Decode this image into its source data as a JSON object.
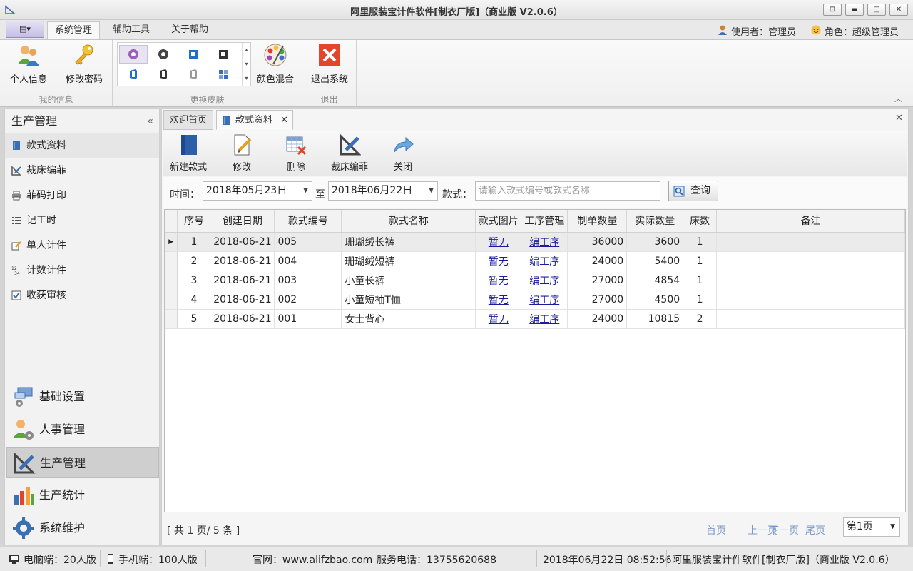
{
  "window": {
    "title": "阿里服装宝计件软件[制衣厂版]（商业版 V2.0.6）"
  },
  "menu": {
    "tabs": [
      {
        "label": "系统管理"
      },
      {
        "label": "辅助工具"
      },
      {
        "label": "关于帮助"
      }
    ],
    "user_label": "使用者：管理员",
    "role_label": "角色：超级管理员"
  },
  "ribbon": {
    "groups": {
      "my_info": "我的信息",
      "skins": "更换皮肤",
      "exit": "退出"
    },
    "buttons": {
      "profile": "个人信息",
      "change_password": "修改密码",
      "color_blend": "颜色混合",
      "exit_system": "退出系统"
    }
  },
  "sidebar": {
    "header": "生产管理",
    "items": [
      {
        "label": "款式资料"
      },
      {
        "label": "裁床编菲"
      },
      {
        "label": "菲码打印"
      },
      {
        "label": "记工时"
      },
      {
        "label": "单人计件"
      },
      {
        "label": "计数计件"
      },
      {
        "label": "收获审核"
      }
    ],
    "nav": [
      {
        "label": "基础设置"
      },
      {
        "label": "人事管理"
      },
      {
        "label": "生产管理"
      },
      {
        "label": "生产统计"
      },
      {
        "label": "系统维护"
      }
    ]
  },
  "doc_tabs": [
    {
      "label": "欢迎首页"
    },
    {
      "label": "款式资料"
    }
  ],
  "toolbar": {
    "new": "新建款式",
    "edit": "修改",
    "delete": "删除",
    "cut": "裁床编菲",
    "close": "关闭"
  },
  "filter": {
    "time_label": "时间：",
    "date_from": "2018年05月23日",
    "to_label": "至",
    "date_to": "2018年06月22日",
    "style_label": "款式：",
    "search_placeholder": "请输入款式编号或款式名称",
    "query_button": "查询"
  },
  "table": {
    "headers": [
      "序号",
      "创建日期",
      "款式编号",
      "款式名称",
      "款式图片",
      "工序管理",
      "制单数量",
      "实际数量",
      "床数",
      "备注"
    ],
    "rows": [
      {
        "no": "1",
        "date": "2018-06-21",
        "code": "005",
        "name": "珊瑚绒长裤",
        "image": "暂无",
        "process": "编工序",
        "order_qty": "36000",
        "actual_qty": "3600",
        "beds": "1",
        "note": ""
      },
      {
        "no": "2",
        "date": "2018-06-21",
        "code": "004",
        "name": "珊瑚绒短裤",
        "image": "暂无",
        "process": "编工序",
        "order_qty": "24000",
        "actual_qty": "5400",
        "beds": "1",
        "note": ""
      },
      {
        "no": "3",
        "date": "2018-06-21",
        "code": "003",
        "name": "小童长裤",
        "image": "暂无",
        "process": "编工序",
        "order_qty": "27000",
        "actual_qty": "4854",
        "beds": "1",
        "note": ""
      },
      {
        "no": "4",
        "date": "2018-06-21",
        "code": "002",
        "name": "小童短袖T恤",
        "image": "暂无",
        "process": "编工序",
        "order_qty": "27000",
        "actual_qty": "4500",
        "beds": "1",
        "note": ""
      },
      {
        "no": "5",
        "date": "2018-06-21",
        "code": "001",
        "name": "女士背心",
        "image": "暂无",
        "process": "编工序",
        "order_qty": "24000",
        "actual_qty": "10815",
        "beds": "2",
        "note": ""
      }
    ]
  },
  "pager": {
    "summary": "[ 共 1 页/ 5 条 ]",
    "first": "首页",
    "prev": "上一页",
    "next": "下一页",
    "last": "尾页",
    "current": "第1页"
  },
  "status": {
    "pc": "电脑端：20人版",
    "mobile": "手机端：100人版",
    "website": "官网：www.alifzbao.com",
    "phone": "服务电话：13755620688",
    "datetime": "2018年06月22日 08:52:56",
    "product": "阿里服装宝计件软件[制衣厂版]（商业版 V2.0.6）"
  }
}
